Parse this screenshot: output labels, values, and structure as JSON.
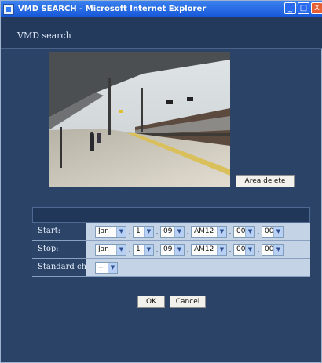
{
  "window": {
    "title": "VMD SEARCH - Microsoft Internet Explorer",
    "controls": {
      "minimize": "_",
      "maximize": "□",
      "close": "X"
    }
  },
  "header": {
    "title": "VMD search"
  },
  "area_delete_label": "Area delete",
  "form": {
    "start": {
      "label": "Start:",
      "month": "Jan",
      "day": "1",
      "year": "09",
      "hour": "AM12",
      "minute": "00",
      "second": "00"
    },
    "stop": {
      "label": "Stop:",
      "month": "Jan",
      "day": "1",
      "year": "09",
      "hour": "AM12",
      "minute": "00",
      "second": "00"
    },
    "standard_ch": {
      "label": "Standard ch",
      "value": "--"
    },
    "separators": {
      "dot": ".",
      "colon": ":"
    }
  },
  "buttons": {
    "ok": "OK",
    "cancel": "Cancel"
  },
  "icons": {
    "dropdown": "chevron-down-icon"
  }
}
